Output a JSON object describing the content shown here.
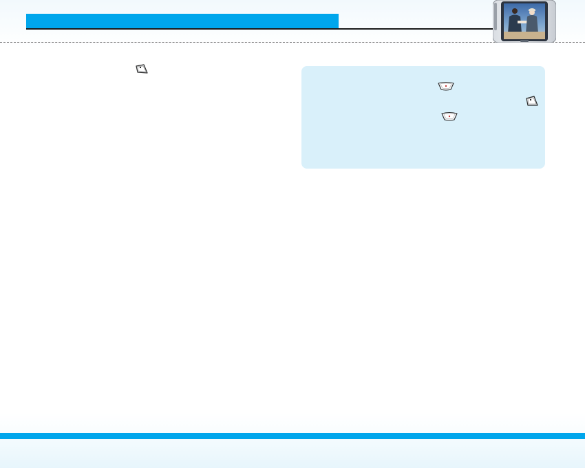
{
  "page": {
    "colors": {
      "accent": "#00a6ec",
      "note_background": "#d9f0fa",
      "rule": "#1a1a1a"
    }
  },
  "icons": {
    "left_column": [
      "left-softkey-icon"
    ],
    "note_box": [
      "ok-key-icon",
      "left-softkey-icon",
      "ok-key-icon"
    ]
  },
  "images": {
    "header_thumbnail": "phone-with-photo-of-two-men"
  }
}
